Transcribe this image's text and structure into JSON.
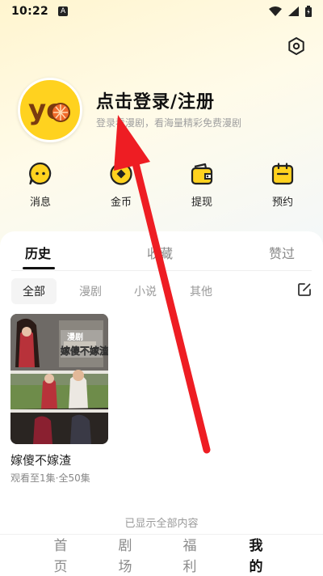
{
  "status_bar": {
    "time": "10:22",
    "notif_letter": "A"
  },
  "profile": {
    "title": "点击登录/注册",
    "subtitle": "登录看漫剧，看海量精彩免费漫剧",
    "avatar_text": "yo"
  },
  "quick_actions": [
    {
      "label": "消息",
      "icon": "chat-bubble-icon"
    },
    {
      "label": "金币",
      "icon": "coin-icon"
    },
    {
      "label": "提现",
      "icon": "wallet-icon"
    },
    {
      "label": "预约",
      "icon": "calendar-icon"
    }
  ],
  "main_tabs": [
    "历史",
    "收藏",
    "赞过"
  ],
  "sub_tabs": [
    "全部",
    "漫剧",
    "小说",
    "其他"
  ],
  "history_item": {
    "poster_text": "嫁傻不嫁渣",
    "poster_tag": "漫剧",
    "title": "嫁傻不嫁渣",
    "progress": "观看至1集·全50集"
  },
  "footer_note": "已显示全部内容",
  "bottom_nav": [
    "首页",
    "剧场",
    "福利",
    "我的"
  ],
  "colors": {
    "accent": "#ffd21f",
    "arrow": "#ee1d23"
  }
}
